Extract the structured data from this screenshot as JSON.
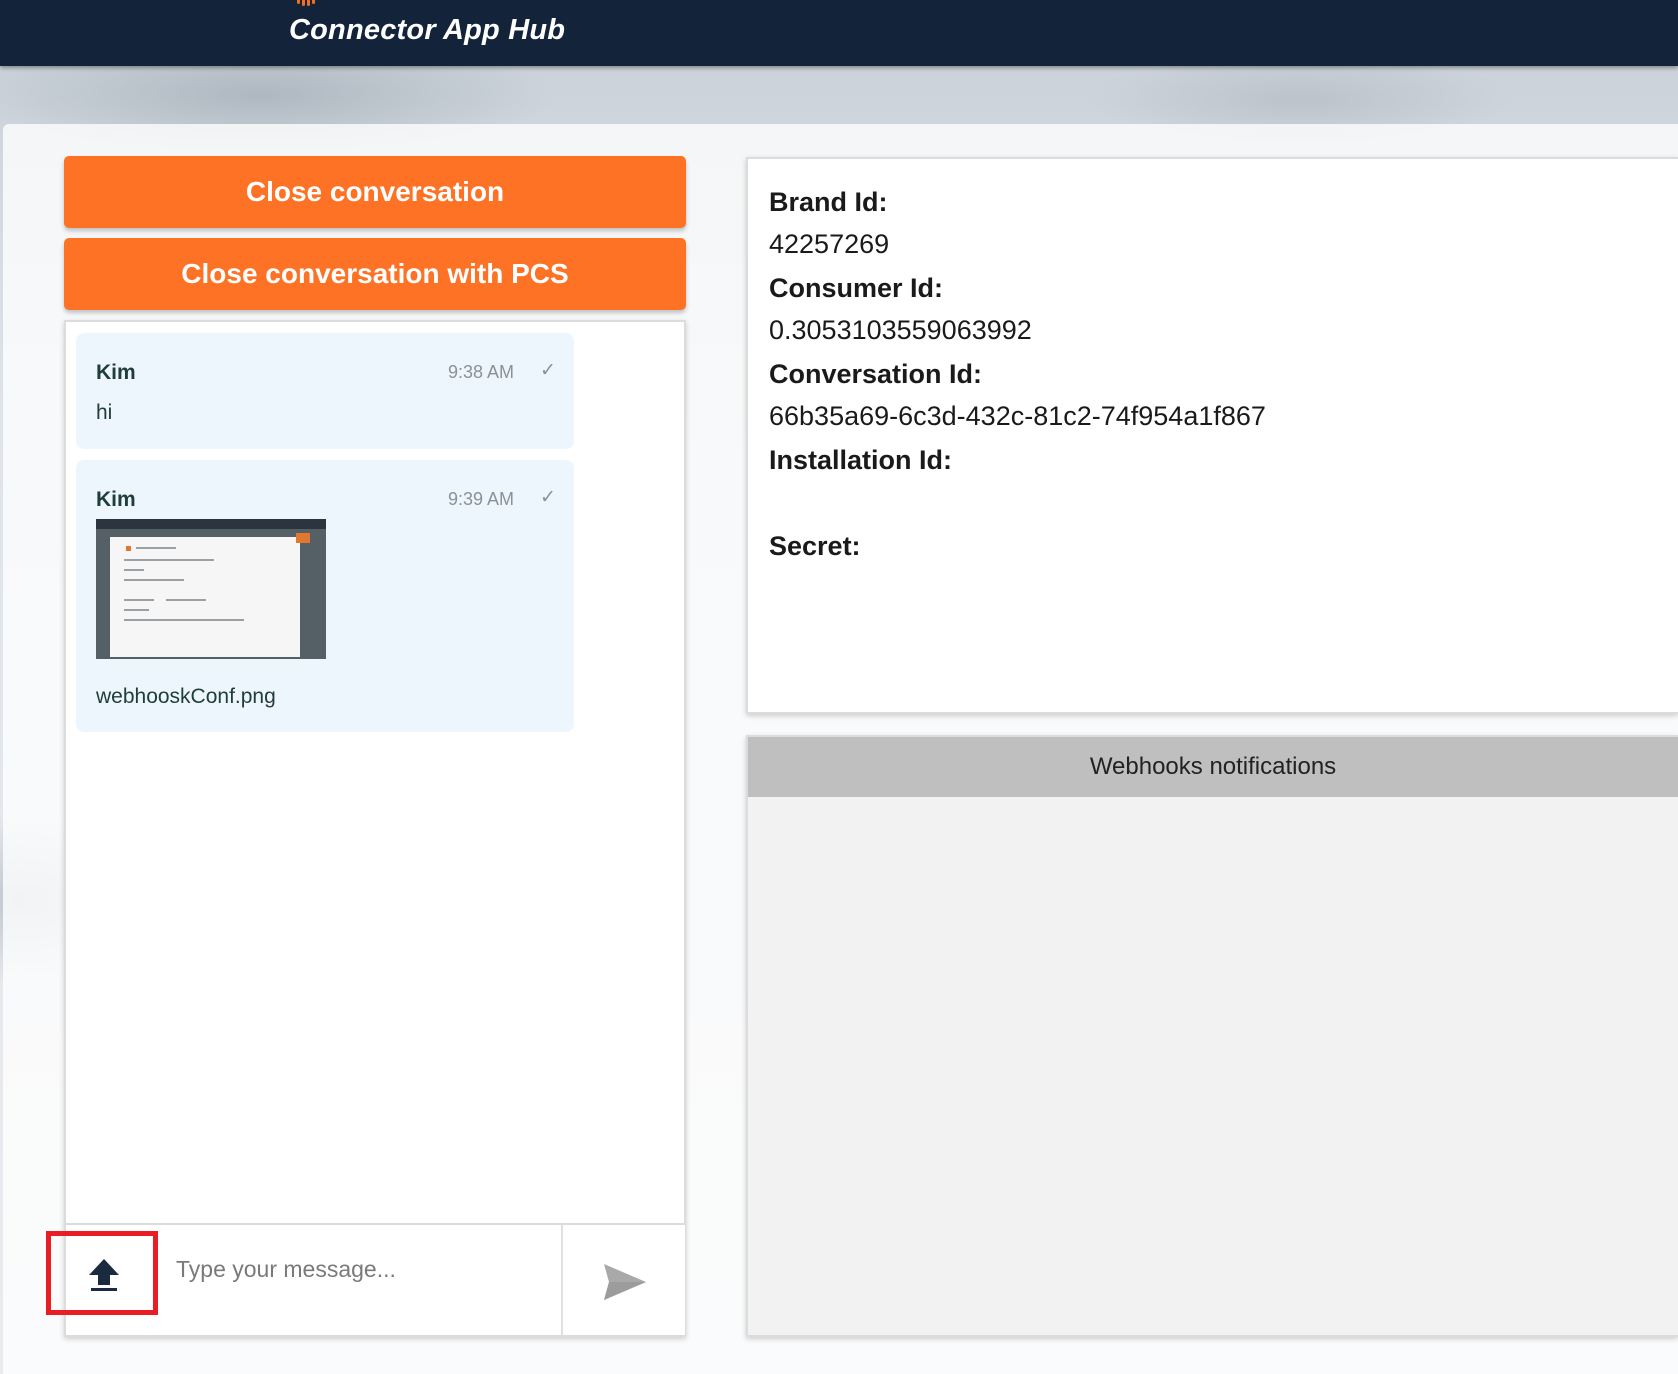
{
  "header": {
    "app_title": "Connector App Hub"
  },
  "actions": {
    "close_conversation": "Close conversation",
    "close_conversation_pcs": "Close conversation with PCS"
  },
  "chat": {
    "messages": [
      {
        "sender": "Kim",
        "time": "9:38 AM",
        "status_icon": "✓",
        "text": "hi"
      },
      {
        "sender": "Kim",
        "time": "9:39 AM",
        "status_icon": "✓",
        "attachment_name": "webhooskConf.png"
      }
    ],
    "composer": {
      "placeholder": "Type your message...",
      "upload_icon": "upload-icon",
      "send_icon": "send-icon"
    }
  },
  "info": {
    "brand_label": "Brand Id:",
    "brand_value": "42257269",
    "consumer_label": "Consumer Id:",
    "consumer_value": "0.3053103559063992",
    "conversation_label": "Conversation Id:",
    "conversation_value": "66b35a69-6c3d-432c-81c2-74f954a1f867",
    "installation_label": "Installation Id:",
    "installation_value": "",
    "secret_label": "Secret:",
    "secret_value": ""
  },
  "webhooks": {
    "title": "Webhooks notifications"
  },
  "colors": {
    "topbar": "#13243a",
    "accent": "#fd7225",
    "highlight": "#ea1c24",
    "bubble": "#eef6fd"
  }
}
